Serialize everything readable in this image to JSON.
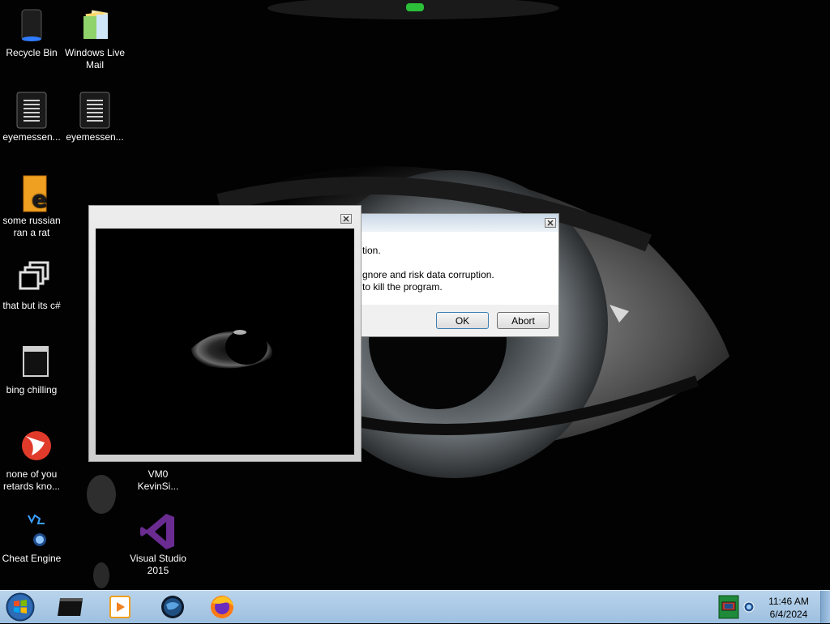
{
  "desktop": {
    "icons": [
      {
        "label": "Recycle Bin",
        "icon": "recycle-bin-icon"
      },
      {
        "label": "Windows Live Mail",
        "icon": "mail-icon"
      },
      {
        "label": "eyemessen...",
        "icon": "text-file-icon"
      },
      {
        "label": "eyemessen...",
        "icon": "text-file-icon"
      },
      {
        "label": "some russian ran a rat",
        "icon": "java-file-icon"
      },
      {
        "label": "that but its c#",
        "icon": "windows-stack-icon"
      },
      {
        "label": "bing chilling",
        "icon": "cmd-icon"
      },
      {
        "label": "none of you retards kno...",
        "icon": "red-globe-icon"
      },
      {
        "label": "VM0 KevinSi...",
        "icon": "blank-icon"
      },
      {
        "label": "Cheat Engine",
        "icon": "cheat-engine-icon"
      },
      {
        "label": "Visual Studio 2015",
        "icon": "visual-studio-icon"
      }
    ]
  },
  "error_dialog": {
    "line1": "tion.",
    "line2": "gnore and risk data corruption.",
    "line3": "to kill the program.",
    "ok_label": "OK",
    "abort_label": "Abort"
  },
  "taskbar": {
    "apps": [
      "cmd-icon",
      "media-player-icon",
      "globe-icon",
      "firefox-icon"
    ],
    "clock_time": "11:46 AM",
    "clock_date": "6/4/2024"
  },
  "colors": {
    "taskbar": "#a9c8e6",
    "dialog_bg": "#f0f0f0",
    "accent_blue": "#3c7fb1"
  }
}
